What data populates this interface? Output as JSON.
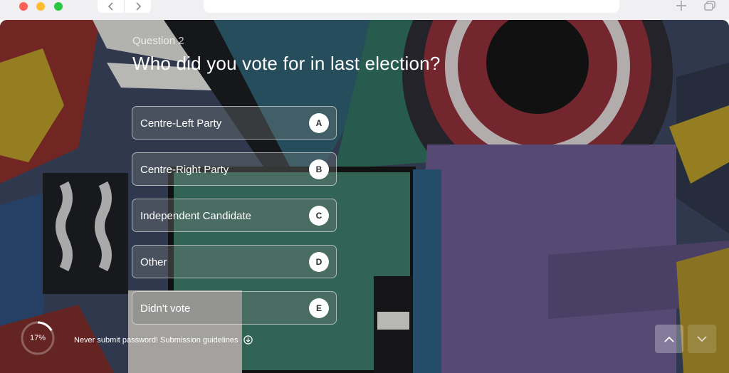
{
  "question": {
    "number_label": "Question 2",
    "title": "Who did you vote for in last election?"
  },
  "options": [
    {
      "label": "Centre-Left Party",
      "key": "A"
    },
    {
      "label": "Centre-Right Party",
      "key": "B"
    },
    {
      "label": "Independent Candidate",
      "key": "C"
    },
    {
      "label": "Other",
      "key": "D"
    },
    {
      "label": "Didn't vote",
      "key": "E"
    }
  ],
  "progress": {
    "percent": 17,
    "label": "17%"
  },
  "footer": {
    "note": "Never submit password! Submission guidelines"
  },
  "icons": {
    "back": "chevron-left-icon",
    "forward": "chevron-right-icon",
    "new_tab": "plus-icon",
    "tabs": "tabs-overview-icon",
    "guidelines": "download-circle-icon",
    "prev": "chevron-up-icon",
    "next": "chevron-down-icon"
  },
  "colors": {
    "close": "#fe5f57",
    "minimize": "#febc2e",
    "maximize": "#28c840",
    "text": "#ffffff"
  }
}
